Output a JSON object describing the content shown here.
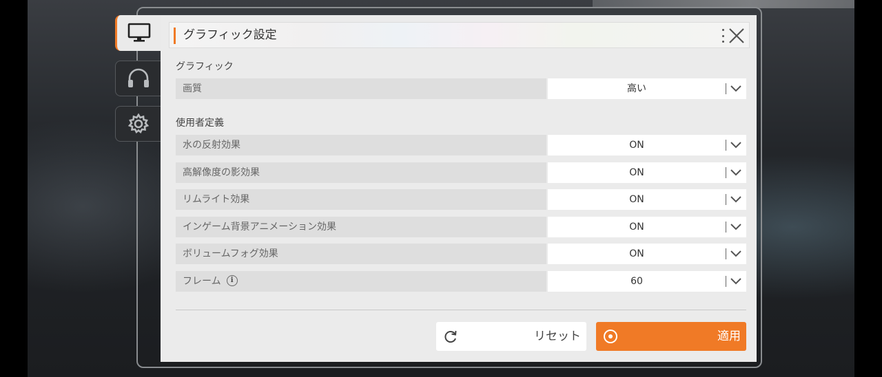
{
  "window": {
    "title": "グラフィック設定"
  },
  "side_tabs": [
    {
      "icon": "monitor-icon",
      "active": true
    },
    {
      "icon": "headphones-icon",
      "active": false
    },
    {
      "icon": "gear-icon",
      "active": false
    }
  ],
  "sections": {
    "graphics": {
      "title": "グラフィック",
      "rows": [
        {
          "label": "画質",
          "value": "高い"
        }
      ]
    },
    "custom": {
      "title": "使用者定義",
      "rows": [
        {
          "label": "水の反射効果",
          "value": "ON"
        },
        {
          "label": "高解像度の影効果",
          "value": "ON"
        },
        {
          "label": "リムライト効果",
          "value": "ON"
        },
        {
          "label": "インゲーム背景アニメーション効果",
          "value": "ON"
        },
        {
          "label": "ボリュームフォグ効果",
          "value": "ON"
        },
        {
          "label": "フレーム",
          "value": "60",
          "info_icon": "i"
        }
      ]
    }
  },
  "buttons": {
    "reset_label": "リセット",
    "apply_label": "適用"
  },
  "colors": {
    "accent": "#f07a26",
    "panel": "#ebebeb",
    "row_label_bg": "#dedede",
    "dropdown_bg": "#ffffff"
  }
}
